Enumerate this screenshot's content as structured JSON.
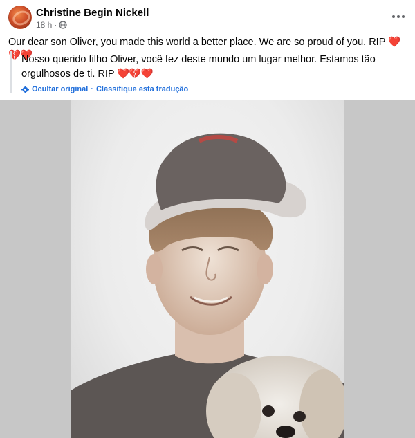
{
  "post": {
    "author": "Christine Begin Nickell",
    "time": "18 h",
    "separator": "·",
    "text": "Our dear son Oliver, you made this world a better place. We are so proud of you. RIP",
    "emoji": "❤️💔❤️",
    "translation": {
      "text": "Nosso querido filho Oliver, você fez deste mundo um lugar melhor. Estamos tão orgulhosos de ti. RIP",
      "emoji": "❤️💔❤️",
      "hide_original": "Ocultar original",
      "dot": "·",
      "rate_translation": "Classifique esta tradução"
    }
  },
  "colors": {
    "link": "#216fdb",
    "secondary_text": "#65676b",
    "heart": "#e0162b"
  },
  "icons": [
    "globe-icon",
    "more-options-icon",
    "translation-gear-icon"
  ]
}
